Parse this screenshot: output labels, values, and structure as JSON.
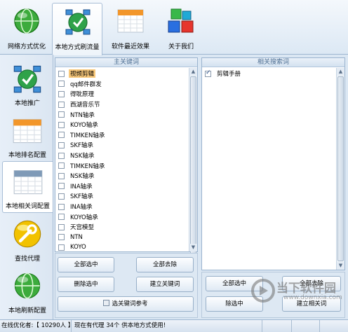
{
  "top_tabs": [
    {
      "label": "网络方式优化",
      "icon": "globe-icon"
    },
    {
      "label": "本地方式刷流量",
      "icon": "network-icon",
      "active": true
    },
    {
      "label": "软件最近效果",
      "icon": "calendar-icon"
    },
    {
      "label": "关于我们",
      "icon": "cubes-icon"
    }
  ],
  "sidebar": [
    {
      "label": "本地推广",
      "icon": "network-icon"
    },
    {
      "label": "本地排名配置",
      "icon": "calendar-icon"
    },
    {
      "label": "本地相关词配置",
      "icon": "calendar-icon",
      "active": true
    },
    {
      "label": "查找代理",
      "icon": "wrench-icon"
    },
    {
      "label": "本地刷新配置",
      "icon": "globe-icon"
    }
  ],
  "main_keywords": {
    "title": "主关键词",
    "items": [
      {
        "text": "视频剪辑",
        "checked": false,
        "selected": true
      },
      {
        "text": "qq邮件群发",
        "checked": false
      },
      {
        "text": "得耽原理",
        "checked": false
      },
      {
        "text": "西湖音乐节",
        "checked": false
      },
      {
        "text": "NTN轴承",
        "checked": false
      },
      {
        "text": "KOYO轴承",
        "checked": false
      },
      {
        "text": "TIMKEN轴承",
        "checked": false
      },
      {
        "text": "SKF轴承",
        "checked": false
      },
      {
        "text": "NSK轴承",
        "checked": false
      },
      {
        "text": "TIMKEN轴承",
        "checked": false
      },
      {
        "text": "NSK轴承",
        "checked": false
      },
      {
        "text": "INA轴承",
        "checked": false
      },
      {
        "text": "SKF轴承",
        "checked": false
      },
      {
        "text": "INA轴承",
        "checked": false
      },
      {
        "text": "KOYO轴承",
        "checked": false
      },
      {
        "text": "天宫模型",
        "checked": false
      },
      {
        "text": "NTN",
        "checked": false
      },
      {
        "text": "KOYO",
        "checked": false
      }
    ],
    "buttons": {
      "select_all": "全部选中",
      "deselect_all": "全部去除",
      "delete_selected": "删除选中",
      "create_keyword": "建立关键词",
      "reference": "选关键词参考"
    }
  },
  "related_keywords": {
    "title": "相关搜索词",
    "items": [
      {
        "text": "剪辑手册",
        "checked": true
      }
    ],
    "buttons": {
      "select_all": "全部选中",
      "deselect_all": "全部去除",
      "delete_selected": "除选中",
      "create_related": "建立相关词"
    }
  },
  "status": {
    "online": "在线优化者:【 10290人 】",
    "proxy": "现在有代理 34个 供本地方式使用!"
  },
  "watermark": {
    "text": "当下软件园",
    "url": "www.downxia.com"
  }
}
